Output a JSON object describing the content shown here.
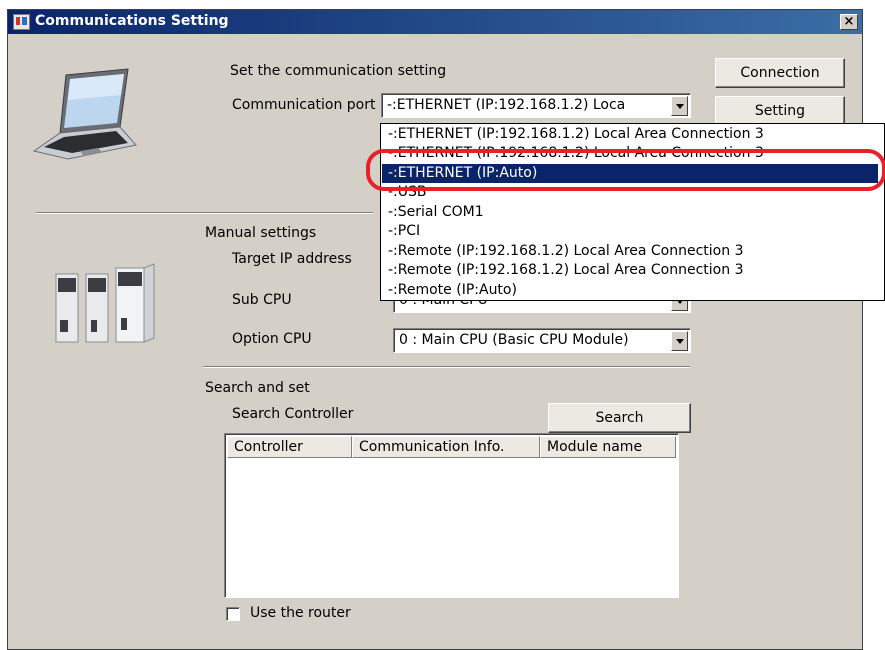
{
  "window": {
    "title": "Communications Setting",
    "close_label": "×"
  },
  "comm": {
    "heading": "Set the communication setting",
    "port_label": "Communication port",
    "port_value": "-:ETHERNET  (IP:192.168.1.2) Loca",
    "connection_button": "Connection",
    "setting_button": "Setting"
  },
  "dropdown": {
    "items": [
      "-:ETHERNET  (IP:192.168.1.2) Local Area Connection 3",
      "-:ETHERNET  (IP:192.168.1.2) Local Area Connection 3",
      "-:ETHERNET  (IP:Auto)",
      "-:USB",
      "-:Serial  COM1",
      "-:PCI",
      "-:Remote  (IP:192.168.1.2) Local Area Connection 3",
      "-:Remote  (IP:192.168.1.2) Local Area Connection 3",
      "-:Remote  (IP:Auto)"
    ],
    "selected_index": 2,
    "highlight_color": "#e8202a",
    "selection_color": "#0a246a"
  },
  "manual": {
    "heading": "Manual settings",
    "target_ip_label": "Target IP address",
    "sub_cpu_label": "Sub CPU",
    "sub_cpu_value": "0 : Main CPU",
    "option_cpu_label": "Option CPU",
    "option_cpu_value": "0 : Main CPU (Basic CPU Module)"
  },
  "search": {
    "heading": "Search and set",
    "controller_label": "Search Controller",
    "search_button": "Search",
    "columns": [
      "Controller",
      "Communication Info.",
      "Module name"
    ]
  },
  "router": {
    "checkbox_label": "Use the router",
    "checked": false
  }
}
